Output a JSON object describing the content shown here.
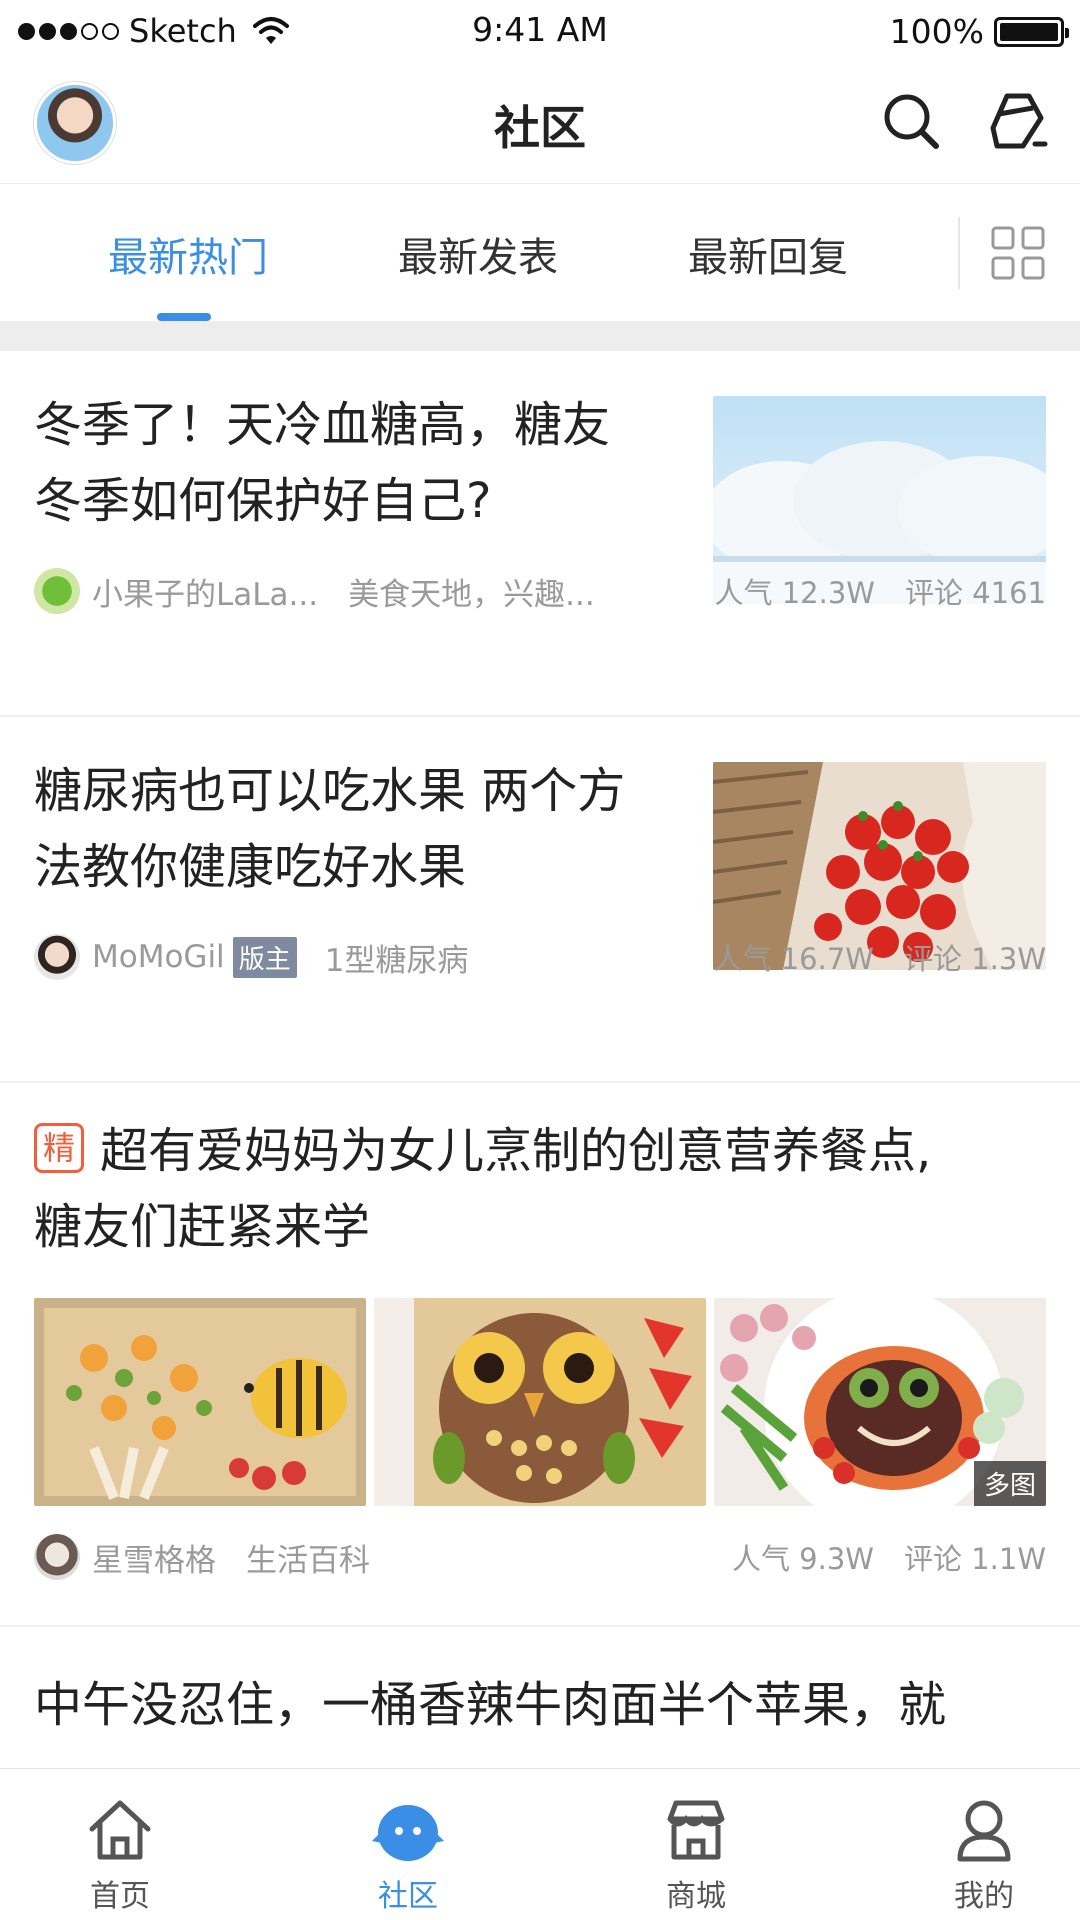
{
  "status_bar": {
    "carrier": "Sketch",
    "time": "9:41 AM",
    "battery": "100%",
    "battery_level": 1.0
  },
  "header": {
    "title": "社区",
    "icons": [
      "avatar",
      "search-icon",
      "edit-icon"
    ]
  },
  "tabs": [
    {
      "label": "最新热门",
      "active": true
    },
    {
      "label": "最新发表",
      "active": false
    },
    {
      "label": "最新回复",
      "active": false
    }
  ],
  "posts": [
    {
      "title_line1": "冬季了！天冷血糖高，糖友",
      "title_line2": "冬季如何保护好自己?",
      "author": "小果子的LaLa...",
      "category": "美食天地，兴趣...",
      "popularity": "人气 12.3W",
      "comments": "评论 4161"
    },
    {
      "title_line1": "糖尿病也可以吃水果 两个方",
      "title_line2": "法教你健康吃好水果",
      "author": "MoMoGil",
      "badge": "版主",
      "category": "1型糖尿病",
      "popularity": "人气 16.7W",
      "comments": "评论 1.3W"
    },
    {
      "tag": "精",
      "title_line1": "超有爱妈妈为女儿烹制的创意营养餐点,",
      "title_line2": "糖友们赶紧来学",
      "multi_image_label": "多图",
      "author": "星雪格格",
      "category": "生活百科",
      "popularity": "人气 9.3W",
      "comments": "评论 1.1W"
    },
    {
      "title_line1": "中午没忍住，一桶香辣牛肉面半个苹果，就"
    }
  ],
  "bottom_nav": [
    {
      "label": "首页",
      "icon": "home-icon",
      "active": false
    },
    {
      "label": "社区",
      "icon": "community-icon",
      "active": true
    },
    {
      "label": "商城",
      "icon": "store-icon",
      "active": false
    },
    {
      "label": "我的",
      "icon": "profile-icon",
      "active": false
    }
  ],
  "colors": {
    "accent": "#3a8ee6",
    "essence_tag": "#f0603a",
    "muted_text": "#9a9a9a",
    "moderator_badge": "#7f8aa0"
  }
}
